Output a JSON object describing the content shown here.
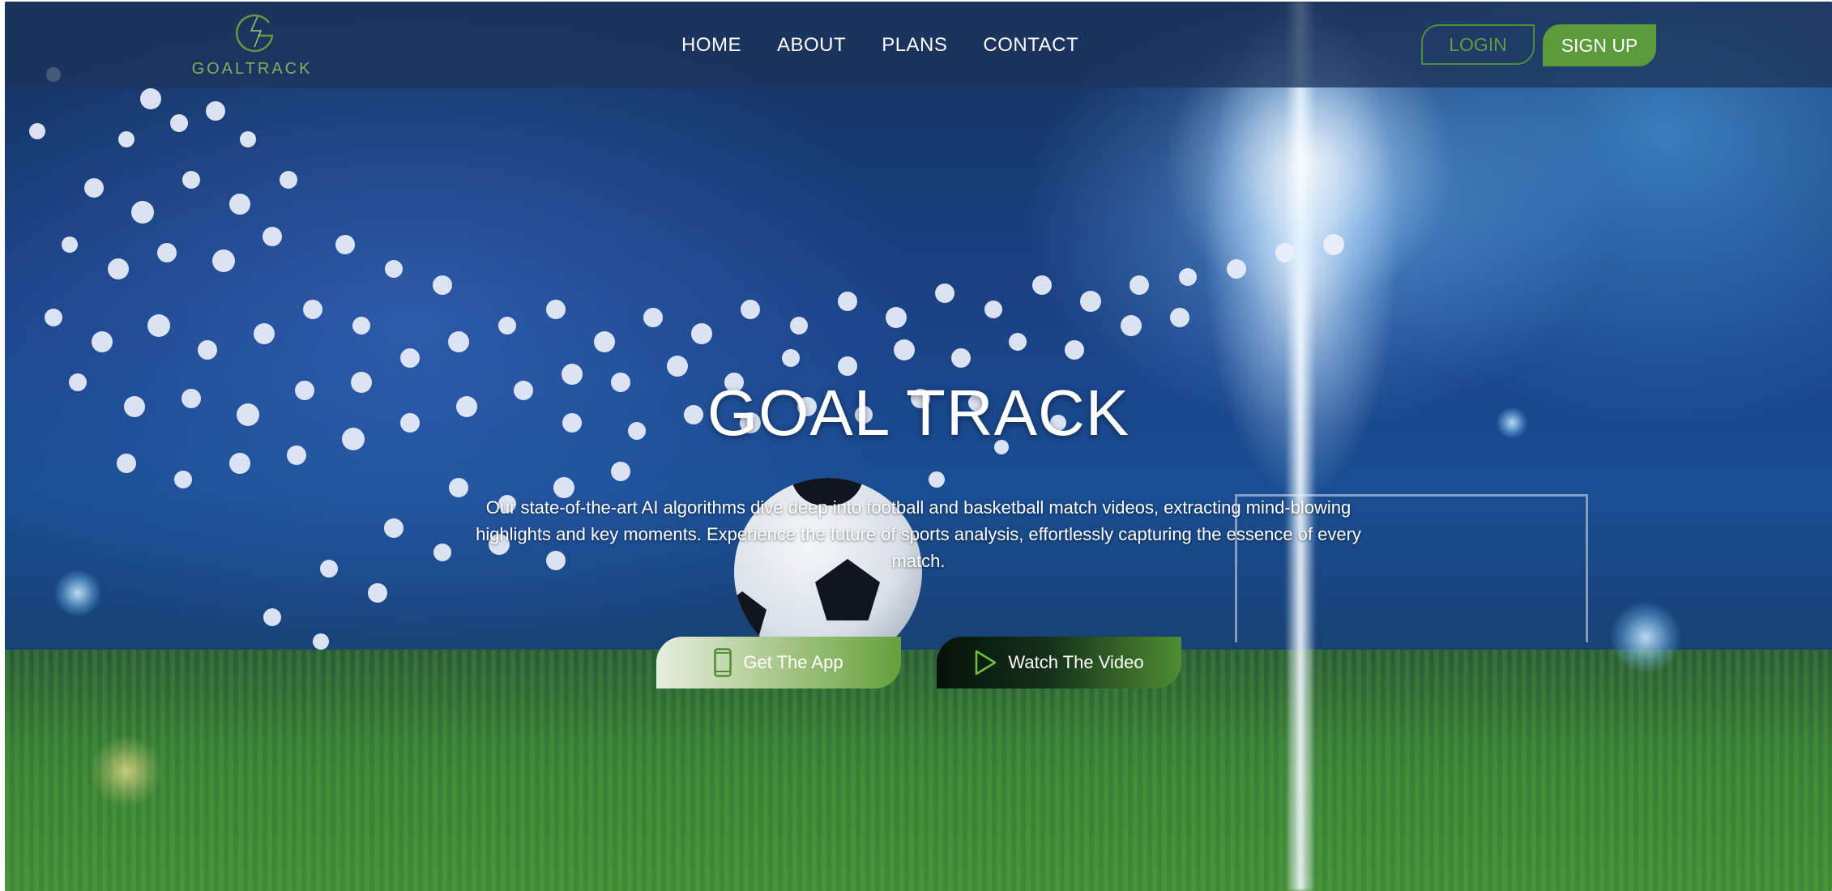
{
  "brand": {
    "name": "GOALTRACK",
    "accent_color": "#5a9a3a"
  },
  "nav": {
    "items": [
      {
        "label": "HOME"
      },
      {
        "label": "ABOUT"
      },
      {
        "label": "PLANS"
      },
      {
        "label": "CONTACT"
      }
    ],
    "login_label": "LOGIN",
    "signup_label": "SIGN UP"
  },
  "hero": {
    "title": "GOAL TRACK",
    "description": "Our state-of-the-art AI algorithms dive deep into football and basketball match videos, extracting mind-blowing highlights and key moments. Experience the future of sports analysis, effortlessly capturing the essence of every match.",
    "primary_button": {
      "label": "Get The App",
      "icon": "smartphone-icon"
    },
    "secondary_button": {
      "label": "Watch The Video",
      "icon": "play-icon"
    }
  }
}
